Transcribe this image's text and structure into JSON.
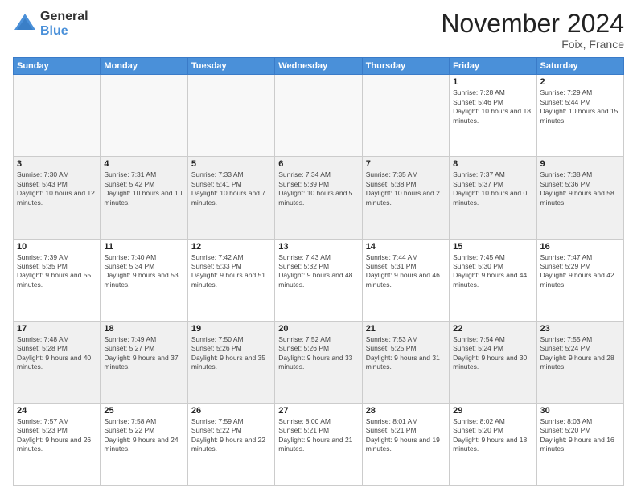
{
  "logo": {
    "general": "General",
    "blue": "Blue"
  },
  "title": "November 2024",
  "location": "Foix, France",
  "days_header": [
    "Sunday",
    "Monday",
    "Tuesday",
    "Wednesday",
    "Thursday",
    "Friday",
    "Saturday"
  ],
  "weeks": [
    [
      {
        "day": "",
        "info": ""
      },
      {
        "day": "",
        "info": ""
      },
      {
        "day": "",
        "info": ""
      },
      {
        "day": "",
        "info": ""
      },
      {
        "day": "",
        "info": ""
      },
      {
        "day": "1",
        "info": "Sunrise: 7:28 AM\nSunset: 5:46 PM\nDaylight: 10 hours and 18 minutes."
      },
      {
        "day": "2",
        "info": "Sunrise: 7:29 AM\nSunset: 5:44 PM\nDaylight: 10 hours and 15 minutes."
      }
    ],
    [
      {
        "day": "3",
        "info": "Sunrise: 7:30 AM\nSunset: 5:43 PM\nDaylight: 10 hours and 12 minutes."
      },
      {
        "day": "4",
        "info": "Sunrise: 7:31 AM\nSunset: 5:42 PM\nDaylight: 10 hours and 10 minutes."
      },
      {
        "day": "5",
        "info": "Sunrise: 7:33 AM\nSunset: 5:41 PM\nDaylight: 10 hours and 7 minutes."
      },
      {
        "day": "6",
        "info": "Sunrise: 7:34 AM\nSunset: 5:39 PM\nDaylight: 10 hours and 5 minutes."
      },
      {
        "day": "7",
        "info": "Sunrise: 7:35 AM\nSunset: 5:38 PM\nDaylight: 10 hours and 2 minutes."
      },
      {
        "day": "8",
        "info": "Sunrise: 7:37 AM\nSunset: 5:37 PM\nDaylight: 10 hours and 0 minutes."
      },
      {
        "day": "9",
        "info": "Sunrise: 7:38 AM\nSunset: 5:36 PM\nDaylight: 9 hours and 58 minutes."
      }
    ],
    [
      {
        "day": "10",
        "info": "Sunrise: 7:39 AM\nSunset: 5:35 PM\nDaylight: 9 hours and 55 minutes."
      },
      {
        "day": "11",
        "info": "Sunrise: 7:40 AM\nSunset: 5:34 PM\nDaylight: 9 hours and 53 minutes."
      },
      {
        "day": "12",
        "info": "Sunrise: 7:42 AM\nSunset: 5:33 PM\nDaylight: 9 hours and 51 minutes."
      },
      {
        "day": "13",
        "info": "Sunrise: 7:43 AM\nSunset: 5:32 PM\nDaylight: 9 hours and 48 minutes."
      },
      {
        "day": "14",
        "info": "Sunrise: 7:44 AM\nSunset: 5:31 PM\nDaylight: 9 hours and 46 minutes."
      },
      {
        "day": "15",
        "info": "Sunrise: 7:45 AM\nSunset: 5:30 PM\nDaylight: 9 hours and 44 minutes."
      },
      {
        "day": "16",
        "info": "Sunrise: 7:47 AM\nSunset: 5:29 PM\nDaylight: 9 hours and 42 minutes."
      }
    ],
    [
      {
        "day": "17",
        "info": "Sunrise: 7:48 AM\nSunset: 5:28 PM\nDaylight: 9 hours and 40 minutes."
      },
      {
        "day": "18",
        "info": "Sunrise: 7:49 AM\nSunset: 5:27 PM\nDaylight: 9 hours and 37 minutes."
      },
      {
        "day": "19",
        "info": "Sunrise: 7:50 AM\nSunset: 5:26 PM\nDaylight: 9 hours and 35 minutes."
      },
      {
        "day": "20",
        "info": "Sunrise: 7:52 AM\nSunset: 5:26 PM\nDaylight: 9 hours and 33 minutes."
      },
      {
        "day": "21",
        "info": "Sunrise: 7:53 AM\nSunset: 5:25 PM\nDaylight: 9 hours and 31 minutes."
      },
      {
        "day": "22",
        "info": "Sunrise: 7:54 AM\nSunset: 5:24 PM\nDaylight: 9 hours and 30 minutes."
      },
      {
        "day": "23",
        "info": "Sunrise: 7:55 AM\nSunset: 5:24 PM\nDaylight: 9 hours and 28 minutes."
      }
    ],
    [
      {
        "day": "24",
        "info": "Sunrise: 7:57 AM\nSunset: 5:23 PM\nDaylight: 9 hours and 26 minutes."
      },
      {
        "day": "25",
        "info": "Sunrise: 7:58 AM\nSunset: 5:22 PM\nDaylight: 9 hours and 24 minutes."
      },
      {
        "day": "26",
        "info": "Sunrise: 7:59 AM\nSunset: 5:22 PM\nDaylight: 9 hours and 22 minutes."
      },
      {
        "day": "27",
        "info": "Sunrise: 8:00 AM\nSunset: 5:21 PM\nDaylight: 9 hours and 21 minutes."
      },
      {
        "day": "28",
        "info": "Sunrise: 8:01 AM\nSunset: 5:21 PM\nDaylight: 9 hours and 19 minutes."
      },
      {
        "day": "29",
        "info": "Sunrise: 8:02 AM\nSunset: 5:20 PM\nDaylight: 9 hours and 18 minutes."
      },
      {
        "day": "30",
        "info": "Sunrise: 8:03 AM\nSunset: 5:20 PM\nDaylight: 9 hours and 16 minutes."
      }
    ]
  ]
}
